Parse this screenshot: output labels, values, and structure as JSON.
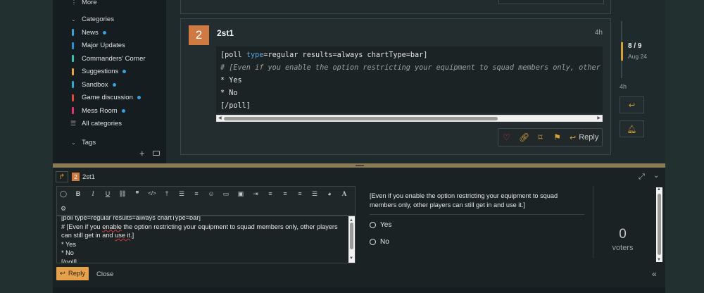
{
  "sidebar": {
    "more_label": "More",
    "categories_heading": "Categories",
    "categories": [
      {
        "label": "News",
        "color": "#3ba0d8",
        "dot": true
      },
      {
        "label": "Major Updates",
        "color": "#2d8fd4",
        "dot": false
      },
      {
        "label": "Commanders' Corner",
        "color": "#3cc0b0",
        "dot": false
      },
      {
        "label": "Suggestions",
        "color": "#f0a23c",
        "dot": true
      },
      {
        "label": "Sandbox",
        "color": "#2fa9c9",
        "dot": true
      },
      {
        "label": "Game discussion",
        "color": "#e1483d",
        "dot": true
      },
      {
        "label": "Mess Room",
        "color": "#e0317a",
        "dot": true
      }
    ],
    "all_categories_label": "All categories",
    "tags_heading": "Tags"
  },
  "post": {
    "avatar_letter": "2",
    "username": "2st1",
    "time": "4h",
    "code_line1_a": "[poll ",
    "code_line1_kw1": "type",
    "code_line1_b": "=regular results=always chartType=bar]",
    "code_line2": "# [Even if you enable the option restricting your equipment to squad members only, other players can still get in and use it.]",
    "code_line3": "* Yes",
    "code_line4": "* No",
    "code_line5": "[/poll]",
    "reply_label": "Reply"
  },
  "timeline": {
    "position": "8 / 9",
    "date": "Aug 24",
    "last_time": "4h"
  },
  "composer": {
    "avatar_letter": "2",
    "username": "2st1",
    "editor_line0": "[poll type=regular results=always chartType=bar]",
    "editor_line1a": "# [Even if you ",
    "editor_line1b": "enable",
    "editor_line1c": " the option restricting your equipment to squad members only, other players can still get in and ",
    "editor_line1d": "use it",
    "editor_line1e": ".]",
    "editor_line2": "* Yes",
    "editor_line3": "* No",
    "editor_line4": "[/poll]",
    "reply_label": "Reply",
    "close_label": "Close"
  },
  "preview": {
    "question": "[Even if you enable the option restricting your equipment to squad members only, other players can still get in and use it.]",
    "options": [
      "Yes",
      "No"
    ],
    "voter_count": "0",
    "voters_label": "voters"
  },
  "colors": {
    "accent": "#d5a13c",
    "reply_button": "#e5a24a",
    "avatar": "#d07a43"
  }
}
